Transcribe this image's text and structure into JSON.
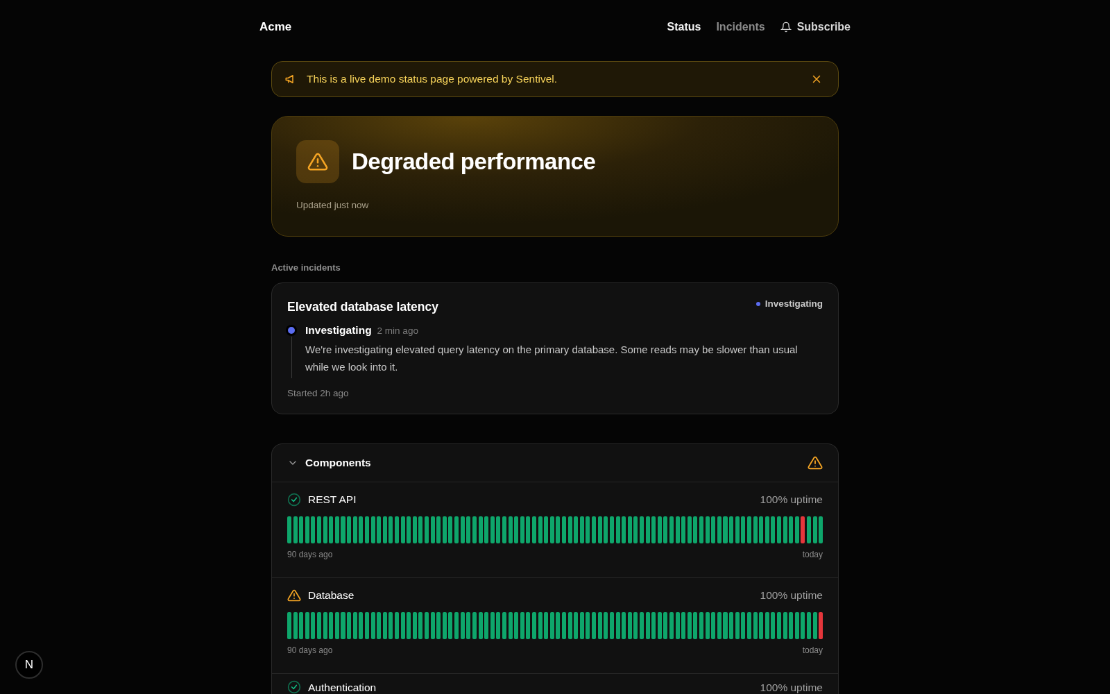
{
  "header": {
    "brand": "Acme",
    "nav": [
      {
        "label": "Status",
        "selected": true
      },
      {
        "label": "Incidents",
        "selected": false
      }
    ],
    "subscribe": {
      "label": "Subscribe"
    }
  },
  "banner": {
    "text": "This is a live demo status page powered by Sentivel.",
    "dismissible": true
  },
  "hero": {
    "kind": "degraded",
    "title": "Degraded performance",
    "updated": "Updated just now"
  },
  "active_incidents": {
    "heading": "Active incidents",
    "incidents": [
      {
        "title": "Elevated database latency",
        "badge": {
          "label": "Investigating",
          "color": "#5b6cf0"
        },
        "updates": [
          {
            "status": "Investigating",
            "time": "2 min ago",
            "color": "#5b6cf0",
            "text": "We're investigating elevated query latency on the primary database. Some reads may be slower than usual while we look into it."
          }
        ],
        "started": "Started 2h ago"
      }
    ]
  },
  "components": {
    "title": "Components",
    "expanded": true,
    "kind": "degraded",
    "items": [
      {
        "name": "REST API",
        "kind": "operational",
        "uptime": "100% uptime",
        "start_label": "90 days ago",
        "end_label": "today",
        "days": [
          {
            "outage": false
          },
          {
            "outage": false
          },
          {
            "outage": false
          },
          {
            "outage": false
          },
          {
            "outage": false
          },
          {
            "outage": false
          },
          {
            "outage": false
          },
          {
            "outage": false
          },
          {
            "outage": false
          },
          {
            "outage": false
          },
          {
            "outage": false
          },
          {
            "outage": false
          },
          {
            "outage": false
          },
          {
            "outage": false
          },
          {
            "outage": false
          },
          {
            "outage": false
          },
          {
            "outage": false
          },
          {
            "outage": false
          },
          {
            "outage": false
          },
          {
            "outage": false
          },
          {
            "outage": false
          },
          {
            "outage": false
          },
          {
            "outage": false
          },
          {
            "outage": false
          },
          {
            "outage": false
          },
          {
            "outage": false
          },
          {
            "outage": false
          },
          {
            "outage": false
          },
          {
            "outage": false
          },
          {
            "outage": false
          },
          {
            "outage": false
          },
          {
            "outage": false
          },
          {
            "outage": false
          },
          {
            "outage": false
          },
          {
            "outage": false
          },
          {
            "outage": false
          },
          {
            "outage": false
          },
          {
            "outage": false
          },
          {
            "outage": false
          },
          {
            "outage": false
          },
          {
            "outage": false
          },
          {
            "outage": false
          },
          {
            "outage": false
          },
          {
            "outage": false
          },
          {
            "outage": false
          },
          {
            "outage": false
          },
          {
            "outage": false
          },
          {
            "outage": false
          },
          {
            "outage": false
          },
          {
            "outage": false
          },
          {
            "outage": false
          },
          {
            "outage": false
          },
          {
            "outage": false
          },
          {
            "outage": false
          },
          {
            "outage": false
          },
          {
            "outage": false
          },
          {
            "outage": false
          },
          {
            "outage": false
          },
          {
            "outage": false
          },
          {
            "outage": false
          },
          {
            "outage": false
          },
          {
            "outage": false
          },
          {
            "outage": false
          },
          {
            "outage": false
          },
          {
            "outage": false
          },
          {
            "outage": false
          },
          {
            "outage": false
          },
          {
            "outage": false
          },
          {
            "outage": false
          },
          {
            "outage": false
          },
          {
            "outage": false
          },
          {
            "outage": false
          },
          {
            "outage": false
          },
          {
            "outage": false
          },
          {
            "outage": false
          },
          {
            "outage": false
          },
          {
            "outage": false
          },
          {
            "outage": false
          },
          {
            "outage": false
          },
          {
            "outage": false
          },
          {
            "outage": false
          },
          {
            "outage": false
          },
          {
            "outage": false
          },
          {
            "outage": false
          },
          {
            "outage": false
          },
          {
            "outage": false
          },
          {
            "outage": true
          },
          {
            "outage": false
          },
          {
            "outage": false
          },
          {
            "outage": false
          }
        ]
      },
      {
        "name": "Database",
        "kind": "degraded",
        "uptime": "100% uptime",
        "start_label": "90 days ago",
        "end_label": "today",
        "days": [
          {
            "outage": false
          },
          {
            "outage": false
          },
          {
            "outage": false
          },
          {
            "outage": false
          },
          {
            "outage": false
          },
          {
            "outage": false
          },
          {
            "outage": false
          },
          {
            "outage": false
          },
          {
            "outage": false
          },
          {
            "outage": false
          },
          {
            "outage": false
          },
          {
            "outage": false
          },
          {
            "outage": false
          },
          {
            "outage": false
          },
          {
            "outage": false
          },
          {
            "outage": false
          },
          {
            "outage": false
          },
          {
            "outage": false
          },
          {
            "outage": false
          },
          {
            "outage": false
          },
          {
            "outage": false
          },
          {
            "outage": false
          },
          {
            "outage": false
          },
          {
            "outage": false
          },
          {
            "outage": false
          },
          {
            "outage": false
          },
          {
            "outage": false
          },
          {
            "outage": false
          },
          {
            "outage": false
          },
          {
            "outage": false
          },
          {
            "outage": false
          },
          {
            "outage": false
          },
          {
            "outage": false
          },
          {
            "outage": false
          },
          {
            "outage": false
          },
          {
            "outage": false
          },
          {
            "outage": false
          },
          {
            "outage": false
          },
          {
            "outage": false
          },
          {
            "outage": false
          },
          {
            "outage": false
          },
          {
            "outage": false
          },
          {
            "outage": false
          },
          {
            "outage": false
          },
          {
            "outage": false
          },
          {
            "outage": false
          },
          {
            "outage": false
          },
          {
            "outage": false
          },
          {
            "outage": false
          },
          {
            "outage": false
          },
          {
            "outage": false
          },
          {
            "outage": false
          },
          {
            "outage": false
          },
          {
            "outage": false
          },
          {
            "outage": false
          },
          {
            "outage": false
          },
          {
            "outage": false
          },
          {
            "outage": false
          },
          {
            "outage": false
          },
          {
            "outage": false
          },
          {
            "outage": false
          },
          {
            "outage": false
          },
          {
            "outage": false
          },
          {
            "outage": false
          },
          {
            "outage": false
          },
          {
            "outage": false
          },
          {
            "outage": false
          },
          {
            "outage": false
          },
          {
            "outage": false
          },
          {
            "outage": false
          },
          {
            "outage": false
          },
          {
            "outage": false
          },
          {
            "outage": false
          },
          {
            "outage": false
          },
          {
            "outage": false
          },
          {
            "outage": false
          },
          {
            "outage": false
          },
          {
            "outage": false
          },
          {
            "outage": false
          },
          {
            "outage": false
          },
          {
            "outage": false
          },
          {
            "outage": false
          },
          {
            "outage": false
          },
          {
            "outage": false
          },
          {
            "outage": false
          },
          {
            "outage": false
          },
          {
            "outage": false
          },
          {
            "outage": false
          },
          {
            "outage": false
          },
          {
            "outage": true
          }
        ]
      },
      {
        "name": "Authentication",
        "kind": "operational",
        "uptime": "100% uptime"
      }
    ]
  },
  "dev_badge": {
    "label": "N"
  }
}
